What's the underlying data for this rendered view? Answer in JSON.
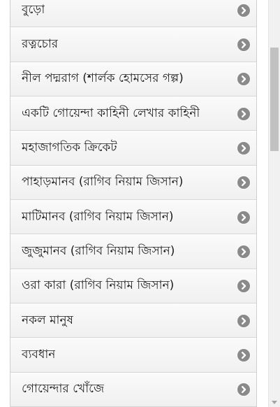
{
  "colors": {
    "list_background": "#f6f6f6",
    "divider": "#d6d6d6",
    "text": "#1e1e1e",
    "chevron_circle": "#8a8a8a",
    "scrollbar_thumb": "#c1c1c1"
  },
  "list": {
    "items": [
      {
        "label": "বুড়ো",
        "icon": "chevron-right-circle-icon"
      },
      {
        "label": "রত্নচোর",
        "icon": "chevron-right-circle-icon"
      },
      {
        "label": "নীল পদ্মরাগ (শার্লক হোমসের গল্প)",
        "icon": "chevron-right-circle-icon"
      },
      {
        "label": "একটি গোয়েন্দা কাহিনী লেখার কাহিনী",
        "icon": "chevron-right-circle-icon"
      },
      {
        "label": "মহাজাগতিক ক্রিকেট",
        "icon": "chevron-right-circle-icon"
      },
      {
        "label": "পাহাড়মানব (রাগিব নিয়াম জিসান)",
        "icon": "chevron-right-circle-icon"
      },
      {
        "label": "মাটিমানব (রাগিব নিয়াম জিসান)",
        "icon": "chevron-right-circle-icon"
      },
      {
        "label": "জুজুমানব (রাগিব নিয়াম জিসান)",
        "icon": "chevron-right-circle-icon"
      },
      {
        "label": "ওরা কারা (রাগিব নিয়াম জিসান)",
        "icon": "chevron-right-circle-icon"
      },
      {
        "label": "নকল মানুষ",
        "icon": "chevron-right-circle-icon"
      },
      {
        "label": "ব্যবধান",
        "icon": "chevron-right-circle-icon"
      },
      {
        "label": "গোয়েন্দার খোঁজে",
        "icon": "chevron-right-circle-icon"
      }
    ]
  }
}
